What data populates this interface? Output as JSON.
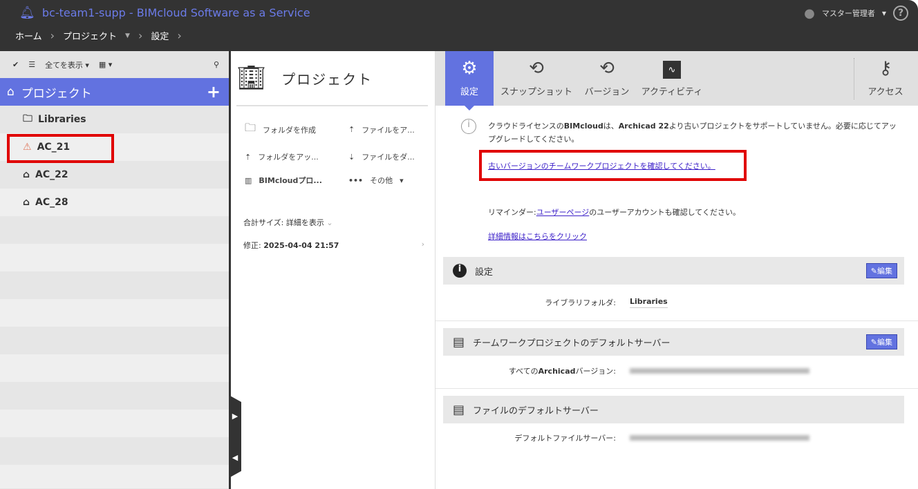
{
  "header": {
    "title": "bc-team1-supp - BIMcloud Software as a Service",
    "user": "マスター管理者",
    "help": "?"
  },
  "breadcrumb": [
    "ホーム",
    "プロジェクト",
    "設定"
  ],
  "sidebar": {
    "filter": "全てを表示",
    "title": "プロジェクト",
    "items": [
      {
        "label": "Libraries",
        "icon": "library-folder"
      },
      {
        "label": "AC_21",
        "icon": "warning"
      },
      {
        "label": "AC_22",
        "icon": "house"
      },
      {
        "label": "AC_28",
        "icon": "house"
      }
    ]
  },
  "middle": {
    "title": "プロジェクト",
    "actions": [
      "フォルダを作成",
      "ファイルをア...",
      "フォルダをアッ...",
      "ファイルをダ...",
      "BIMcloudプロ...",
      "その他"
    ],
    "size_label": "合計サイズ: 詳細を表示",
    "modified_label": "修正:",
    "modified_value": "2025-04-04 21:57"
  },
  "tabs": [
    "設定",
    "スナップショット",
    "バージョン",
    "アクティビティ",
    "アクセス"
  ],
  "notice": {
    "text_a": "クラウドライセンスの",
    "bold_a": "BIMcloud",
    "text_b": "は、",
    "bold_b": "Archicad 22",
    "text_c": "より古いプロジェクトをサポートしていません。必要に応じてアップグレードしてください。",
    "link_old": "古いバージョンのチームワークプロジェクトを確認してください。",
    "reminder_a": "リマインダー:",
    "reminder_link": "ユーザーページ",
    "reminder_b": "のユーザーアカウントも確認してください。",
    "more_link": "詳細情報はこちらをクリック"
  },
  "sections": {
    "settings": {
      "title": "設定",
      "edit": "編集",
      "key": "ライブラリフォルダ:",
      "value": "Libraries"
    },
    "tw_server": {
      "title": "チームワークプロジェクトのデフォルトサーバー",
      "edit": "編集",
      "key_a": "すべての",
      "key_bold": "Archicad",
      "key_b": "バージョン:"
    },
    "file_server": {
      "title": "ファイルのデフォルトサーバー",
      "key": "デフォルトファイルサーバー:"
    }
  },
  "colors": {
    "accent": "#6272e0",
    "highlight": "#e00000",
    "topbar": "#333333"
  }
}
